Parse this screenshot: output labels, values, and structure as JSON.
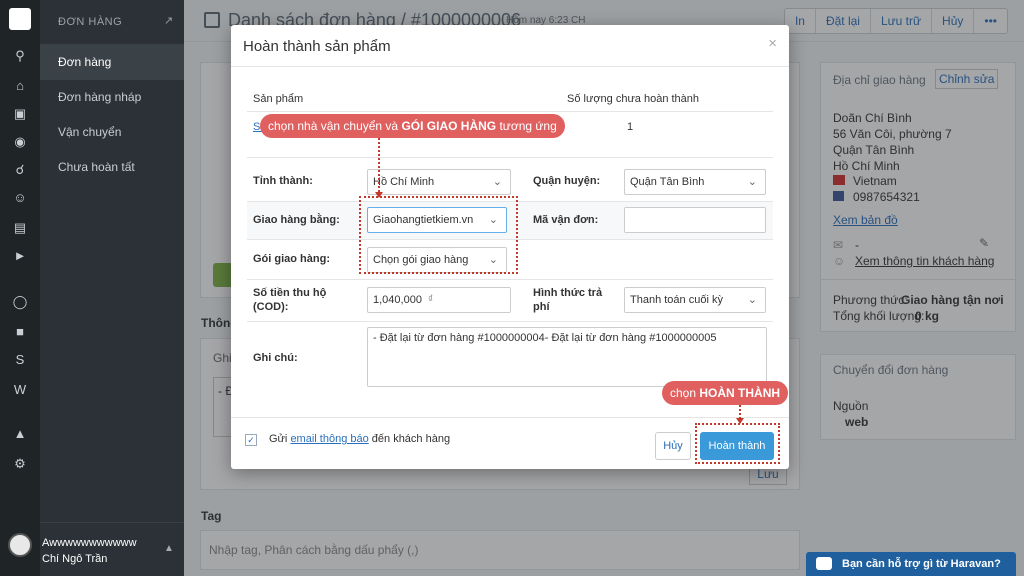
{
  "sidebar": {
    "section_title": "ĐƠN HÀNG",
    "items": [
      {
        "label": "Đơn hàng"
      },
      {
        "label": "Đơn hàng nháp"
      },
      {
        "label": "Vận chuyển"
      },
      {
        "label": "Chưa hoàn tất"
      }
    ],
    "user": {
      "name": "Awwwwwwwwwww",
      "fullname": "Chí Ngô Trần"
    }
  },
  "page": {
    "title": "Danh sách đơn hàng / #1000000006",
    "time": "Hôm nay 6:23 CH",
    "actions": [
      "In",
      "Đặt lại",
      "Lưu trữ",
      "Hủy",
      "•••"
    ]
  },
  "background": {
    "section_info": "Thông",
    "note_label": "Ghi",
    "note_text": "- Đ",
    "save_label": "Lưu",
    "tag_title": "Tag",
    "tag_placeholder": "Nhập tag, Phân cách bằng dấu phẩy (,)",
    "address": {
      "title": "Địa chỉ giao hàng",
      "edit": "Chỉnh sửa",
      "lines": [
        "Doãn Chí Bình",
        "56 Văn Côi, phường 7",
        "Quận Tân Bình",
        "Hồ Chí Minh"
      ],
      "country": "Vietnam",
      "phone": "0987654321",
      "map_link": "Xem bản đồ",
      "email": "-",
      "customer_link": "Xem thông tin khách hàng",
      "method_label": "Phương thức:",
      "method_value": "Giao hàng tận nơi",
      "weight_label": "Tổng khối lượng:",
      "weight_value": "0 kg"
    },
    "convert": {
      "title": "Chuyển đổi đơn hàng",
      "source_label": "Nguồn",
      "source_value": "web"
    }
  },
  "modal": {
    "title": "Hoàn thành sản phẩm",
    "col_product": "Sản phẩm",
    "col_qty": "Số lượng chưa hoàn thành",
    "product_name": "Sả",
    "product_qty": "1",
    "province_label": "Tỉnh thành:",
    "province_value": "Hồ Chí Minh",
    "district_label": "Quận huyện:",
    "district_value": "Quận Tân Bình",
    "carrier_label": "Giao hàng bằng:",
    "carrier_value": "Giaohangtietkiem.vn",
    "tracking_label": "Mã vận đơn:",
    "tracking_value": "",
    "package_label": "Gói giao hàng:",
    "package_value": "Chọn gói giao hàng",
    "cod_label_1": "Số tiền thu hộ",
    "cod_label_2": "(COD):",
    "cod_value": "1,040,000",
    "cod_unit": "₫",
    "payment_label_1": "Hình thức trả",
    "payment_label_2": "phí",
    "payment_value": "Thanh toán cuối kỳ",
    "note_label": "Ghi chú:",
    "note_value": "- Đặt lại từ đơn hàng #1000000004- Đặt lại từ đơn hàng #1000000005",
    "footer_text_1": "Gửi",
    "footer_link": "email thông báo",
    "footer_text_2": "đến khách hàng",
    "cancel_label": "Hủy",
    "done_label": "Hoàn thành"
  },
  "annotations": {
    "top_text": "chọn nhà vận chuyển và",
    "top_bold": "GÓI GIAO HÀNG",
    "top_tail": "tương ứng",
    "bottom_text": "chọn",
    "bottom_bold": "HOÀN THÀNH"
  },
  "help": {
    "label": "Bạn cần hỗ trợ gì từ Haravan?"
  },
  "colors": {
    "accent": "#3a9ad9",
    "annotation": "#e06060",
    "sidebar": "#2b3136"
  }
}
